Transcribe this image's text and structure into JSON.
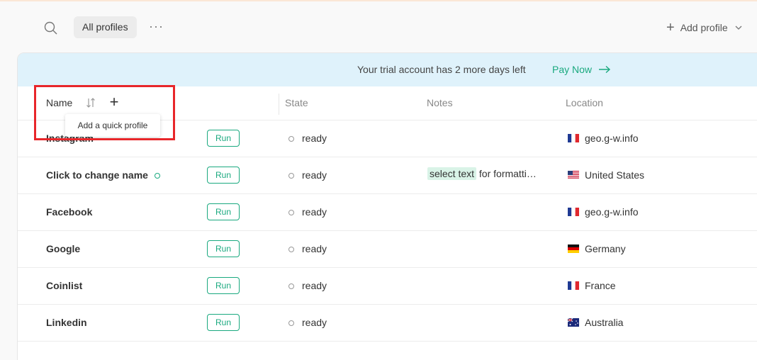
{
  "toolbar": {
    "search_icon": "search-icon",
    "filter_label": "All profiles",
    "more_icon": "···",
    "add_profile_plus": "+",
    "add_profile_label": "Add profile"
  },
  "banner": {
    "text": "Your trial account has 2 more days left",
    "pay_now": "Pay Now"
  },
  "table": {
    "headers": {
      "name": "Name",
      "add_quick": "+",
      "state": "State",
      "notes": "Notes",
      "location": "Location"
    },
    "run_label": "Run",
    "rows": [
      {
        "name": "Instagram",
        "state": "ready",
        "notes_highlight": "",
        "notes_rest": "",
        "location": "geo.g-w.info",
        "flag": "fr"
      },
      {
        "name": "Click to change name",
        "state": "ready",
        "notes_highlight": "select text",
        "notes_rest": " for formatti…",
        "location": "United States",
        "flag": "us"
      },
      {
        "name": "Facebook",
        "state": "ready",
        "notes_highlight": "",
        "notes_rest": "",
        "location": "geo.g-w.info",
        "flag": "fr"
      },
      {
        "name": "Google",
        "state": "ready",
        "notes_highlight": "",
        "notes_rest": "",
        "location": "Germany",
        "flag": "de"
      },
      {
        "name": "Coinlist",
        "state": "ready",
        "notes_highlight": "",
        "notes_rest": "",
        "location": "France",
        "flag": "fr"
      },
      {
        "name": "Linkedin",
        "state": "ready",
        "notes_highlight": "",
        "notes_rest": "",
        "location": "Australia",
        "flag": "au"
      }
    ]
  },
  "tooltip": {
    "text": "Add a quick profile"
  },
  "colors": {
    "accent": "#1aa97f",
    "banner_bg": "#dff2fb",
    "annotation": "#e8262a"
  }
}
